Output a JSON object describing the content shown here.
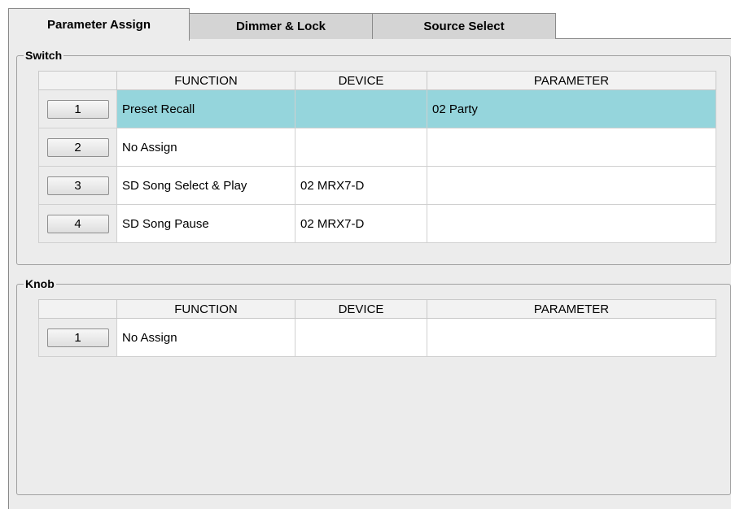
{
  "tabs": [
    {
      "label": "Parameter Assign",
      "active": true
    },
    {
      "label": "Dimmer & Lock",
      "active": false
    },
    {
      "label": "Source Select",
      "active": false
    }
  ],
  "switch": {
    "title": "Switch",
    "columns": [
      "",
      "FUNCTION",
      "DEVICE",
      "PARAMETER"
    ],
    "rows": [
      {
        "button": "1",
        "function": "Preset Recall",
        "device": "",
        "parameter": "02 Party",
        "selected": true
      },
      {
        "button": "2",
        "function": "No Assign",
        "device": "",
        "parameter": "",
        "selected": false
      },
      {
        "button": "3",
        "function": "SD Song Select & Play",
        "device": "02 MRX7-D",
        "parameter": "",
        "selected": false
      },
      {
        "button": "4",
        "function": "SD Song Pause",
        "device": "02 MRX7-D",
        "parameter": "",
        "selected": false
      }
    ]
  },
  "knob": {
    "title": "Knob",
    "columns": [
      "",
      "FUNCTION",
      "DEVICE",
      "PARAMETER"
    ],
    "rows": [
      {
        "button": "1",
        "function": "No Assign",
        "device": "",
        "parameter": "",
        "selected": false
      }
    ]
  },
  "colors": {
    "selected_row": "#95d5dc",
    "panel_bg": "#ececec"
  }
}
